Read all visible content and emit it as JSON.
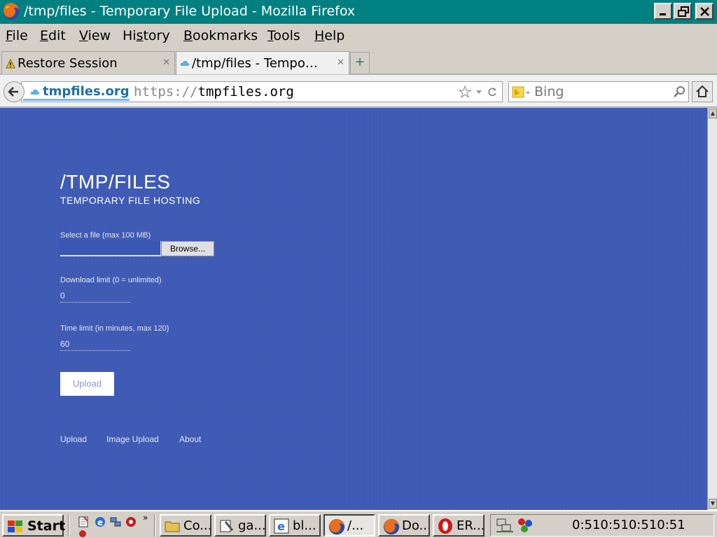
{
  "window": {
    "title": "/tmp/files - Temporary File Upload - Mozilla Firefox"
  },
  "menubar": {
    "items": [
      {
        "label": "File",
        "accel": "F",
        "rest": "ile"
      },
      {
        "label": "Edit",
        "accel": "E",
        "rest": "dit"
      },
      {
        "label": "View",
        "accel": "V",
        "rest": "iew"
      },
      {
        "label": "History",
        "accel": "H",
        "pre": "Hi",
        "accel2": "s",
        "rest": "tory"
      },
      {
        "label": "Bookmarks",
        "accel": "B",
        "rest": "ookmarks"
      },
      {
        "label": "Tools",
        "accel": "T",
        "rest": "ools"
      },
      {
        "label": "Help",
        "accel": "H",
        "rest": "elp"
      }
    ]
  },
  "tabs": [
    {
      "label": "Restore Session",
      "active": false,
      "icon": "warning-icon"
    },
    {
      "label": "/tmp/files - Tempo…",
      "active": true,
      "icon": "cloud-icon"
    }
  ],
  "navbar": {
    "identity": "tmpfiles.org",
    "url_scheme": "https://",
    "url_host": "tmpfiles.org",
    "search_engine": "Bing"
  },
  "page": {
    "title": "/TMP/FILES",
    "subtitle": "TEMPORARY FILE HOSTING",
    "file_label": "Select a file (max 100 MB)",
    "browse_label": "Browse...",
    "download_limit_label": "Download limit (0 = unlimited)",
    "download_limit_value": "0",
    "time_limit_label": "Time limit (in minutes, max 120)",
    "time_limit_value": "60",
    "upload_label": "Upload",
    "footer_links": [
      "Upload",
      "Image Upload",
      "About"
    ],
    "background_color": "#3a57b6"
  },
  "taskbar": {
    "start_label": "Start",
    "tasks": [
      {
        "label": "Co...",
        "icon": "folder-icon",
        "active": false
      },
      {
        "label": "ga...",
        "icon": "tools-icon",
        "active": false
      },
      {
        "label": "bl...",
        "icon": "ie-icon",
        "active": false
      },
      {
        "label": "/...",
        "icon": "firefox-icon",
        "active": true
      },
      {
        "label": "Do...",
        "icon": "firefox-icon",
        "active": false
      },
      {
        "label": "ER...",
        "icon": "opera-icon",
        "active": false
      }
    ],
    "clock": "0:510:510:510:51"
  }
}
